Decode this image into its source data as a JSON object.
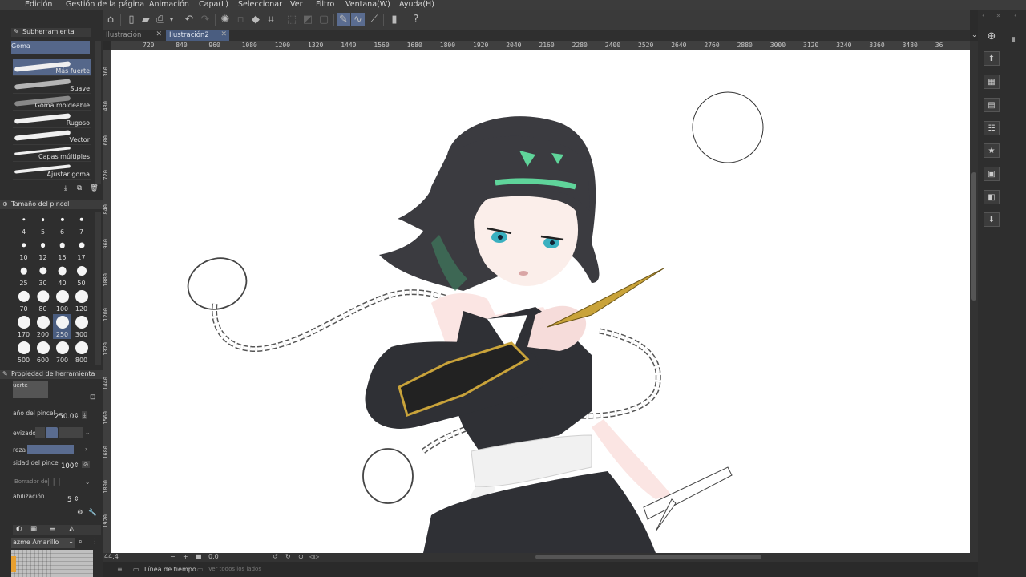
{
  "menu": [
    "Edición",
    "Gestión de la página",
    "Animación",
    "Capa(L)",
    "Seleccionar",
    "Ver",
    "Filtro",
    "Ventana(W)",
    "Ayuda(H)"
  ],
  "tabs": [
    {
      "label": "Ilustración",
      "active": false
    },
    {
      "label": "Ilustración2",
      "active": true
    }
  ],
  "ruler_h": [
    "720",
    "840",
    "960",
    "1080",
    "1200",
    "1320",
    "1440",
    "1560",
    "1680",
    "1800",
    "1920",
    "2040",
    "2160",
    "2280",
    "2400",
    "2520",
    "2640",
    "2760",
    "2880",
    "3000",
    "3120",
    "3240",
    "3360",
    "3480",
    "36"
  ],
  "ruler_v": [
    "360",
    "480",
    "600",
    "720",
    "840",
    "960",
    "1080",
    "1200",
    "1320",
    "1440",
    "1560",
    "1680",
    "1800",
    "1920"
  ],
  "subtool_panel": {
    "title": "Subherramienta",
    "tab": "Goma",
    "items": [
      "Más fuerte",
      "Suave",
      "Goma moldeable",
      "Rugoso",
      "Vector",
      "Capas múltiples",
      "Ajustar goma"
    ]
  },
  "brush_size_panel": {
    "title": "Tamaño del pincel",
    "sizes": [
      "4",
      "5",
      "6",
      "7",
      "10",
      "12",
      "15",
      "17",
      "25",
      "30",
      "40",
      "50",
      "70",
      "80",
      "100",
      "120",
      "170",
      "200",
      "250",
      "300",
      "500",
      "600",
      "700",
      "800"
    ],
    "selected": "250"
  },
  "tool_property_panel": {
    "title": "Propiedad de herramienta",
    "preset": "uerte",
    "brush_size_label": "año del pincel",
    "brush_size_value": "250.0",
    "antialias_label": "evizado",
    "hardness_label": "reza",
    "density_label": "sidad del pincel",
    "density_value": "100",
    "vector_eraser_label": "Borrador de",
    "stabilization_label": "abilización",
    "stabilization_value": "5"
  },
  "color_set": {
    "name": "azme Amarillo"
  },
  "status": {
    "zoom": "44.4",
    "angle": "0.0"
  },
  "bottom": {
    "timeline_label": "Línea de tiempo",
    "show_all_label": "Ver todos los lados"
  },
  "colors": {
    "accent": "#4a5d80",
    "hair_highlight": "#5fd49a",
    "gold": "#c9a33a",
    "eyes": "#3ab0c0"
  },
  "icons": [
    "new-file-icon",
    "open-icon",
    "save-icon",
    "undo-icon",
    "redo-icon",
    "loading-icon",
    "fill-icon",
    "transform-icon",
    "pen-icon",
    "help-icon",
    "navigator-icon",
    "layer-icon"
  ]
}
